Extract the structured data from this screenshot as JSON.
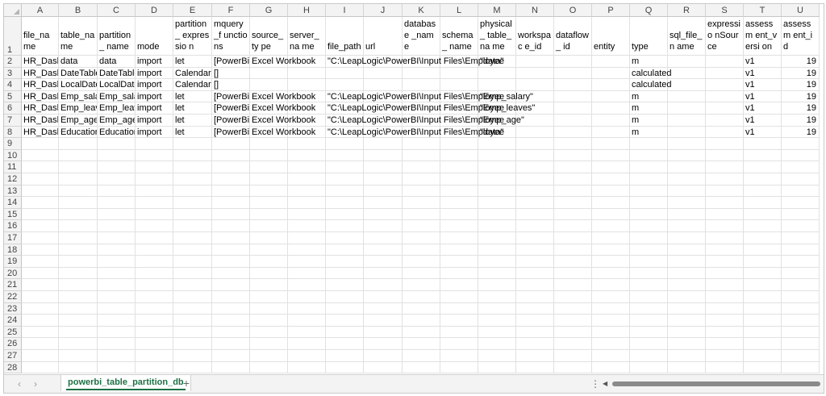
{
  "sheet": {
    "tab_name": "powerbi_table_partition_db",
    "add_sheet_label": "+",
    "nav_prev": "‹",
    "nav_next": "›",
    "more_menu": "⋮",
    "scroll_left": "◀"
  },
  "columns": [
    "A",
    "B",
    "C",
    "D",
    "E",
    "F",
    "G",
    "H",
    "I",
    "J",
    "K",
    "L",
    "M",
    "N",
    "O",
    "P",
    "Q",
    "R",
    "S",
    "T",
    "U"
  ],
  "row_numbers": [
    "1",
    "2",
    "3",
    "4",
    "5",
    "6",
    "7",
    "8",
    "9",
    "10",
    "11",
    "12",
    "13",
    "14",
    "15",
    "16",
    "17",
    "18",
    "19",
    "20",
    "21",
    "22",
    "23",
    "24",
    "25",
    "26",
    "27",
    "28"
  ],
  "headers": [
    "file_name",
    "table_na me",
    "partition_ name",
    "mode",
    "partition_ expressio n",
    "mquery_f unctions",
    "source_ty pe",
    "server_na me",
    "file_path",
    "url",
    "database _name",
    "schema_ name",
    "physical_ table_na me",
    "workspac e_id",
    "dataflow_ id",
    "entity",
    "type",
    "sql_file_n ame",
    "expressio nSource",
    "assessm ent_versi on",
    "assessm ent_id"
  ],
  "rows": [
    [
      "HR_Dashb",
      "data",
      "data",
      "import",
      "let",
      "[PowerBiM",
      "Excel Workbook",
      "",
      "\"C:\\LeapLogic\\PowerBI\\Input Files\\Employee",
      "",
      "",
      "",
      "\"data\"",
      "",
      "",
      "",
      "m",
      "",
      "",
      "v1",
      "19"
    ],
    [
      "HR_Dashb",
      "DateTable",
      "DateTable",
      "import",
      "Calendar(D",
      "[]",
      "",
      "",
      "",
      "",
      "",
      "",
      "",
      "",
      "",
      "",
      "calculated",
      "",
      "",
      "v1",
      "19"
    ],
    [
      "HR_Dashb",
      "LocalDate",
      "LocalDate",
      "import",
      "Calendar(D",
      "[]",
      "",
      "",
      "",
      "",
      "",
      "",
      "",
      "",
      "",
      "",
      "calculated",
      "",
      "",
      "v1",
      "19"
    ],
    [
      "HR_Dashb",
      "Emp_salar",
      "Emp_salar",
      "import",
      "let",
      "[PowerBiM",
      "Excel Workbook",
      "",
      "\"C:\\LeapLogic\\PowerBI\\Input Files\\Employee",
      "",
      "",
      "",
      "\"Emp_salary\"",
      "",
      "",
      "",
      "m",
      "",
      "",
      "v1",
      "19"
    ],
    [
      "HR_Dashb",
      "Emp_leave",
      "Emp_leave",
      "import",
      "let",
      "[PowerBiM",
      "Excel Workbook",
      "",
      "\"C:\\LeapLogic\\PowerBI\\Input Files\\Employee",
      "",
      "",
      "",
      "\"Emp_leaves\"",
      "",
      "",
      "",
      "m",
      "",
      "",
      "v1",
      "19"
    ],
    [
      "HR_Dashb",
      "Emp_age",
      "Emp_age",
      "import",
      "let",
      "[PowerBiM",
      "Excel Workbook",
      "",
      "\"C:\\LeapLogic\\PowerBI\\Input Files\\Employee",
      "",
      "",
      "",
      "\"Emp_age\"",
      "",
      "",
      "",
      "m",
      "",
      "",
      "v1",
      "19"
    ],
    [
      "HR_Dashb",
      "Education",
      "Education",
      "import",
      "let",
      "[PowerBiM",
      "Excel Workbook",
      "",
      "\"C:\\LeapLogic\\PowerBI\\Input Files\\Employee",
      "",
      "",
      "",
      "\"data\"",
      "",
      "",
      "",
      "m",
      "",
      "",
      "v1",
      "19"
    ]
  ]
}
